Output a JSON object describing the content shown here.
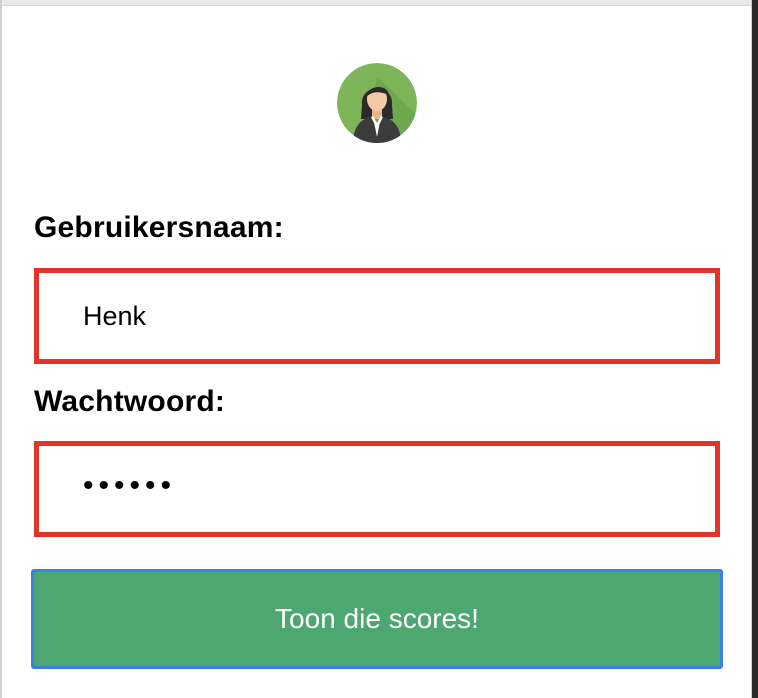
{
  "avatar": {
    "icon": "avatar-woman-icon",
    "colors": {
      "background": "#7eb559",
      "shadow": "#5f9a45",
      "suit": "#3c3c3c",
      "shirt": "#ffffff",
      "skin": "#f4c9a5",
      "hair": "#2b2b2b"
    }
  },
  "form": {
    "username_label": "Gebruikersnaam:",
    "username_value": "Henk",
    "password_label": "Wachtwoord:",
    "password_value": "••••••",
    "submit_label": "Toon die scores!"
  },
  "colors": {
    "field_border_error": "#e3342a",
    "button_background": "#4ca870",
    "button_focus_border": "#3d7ee8"
  }
}
